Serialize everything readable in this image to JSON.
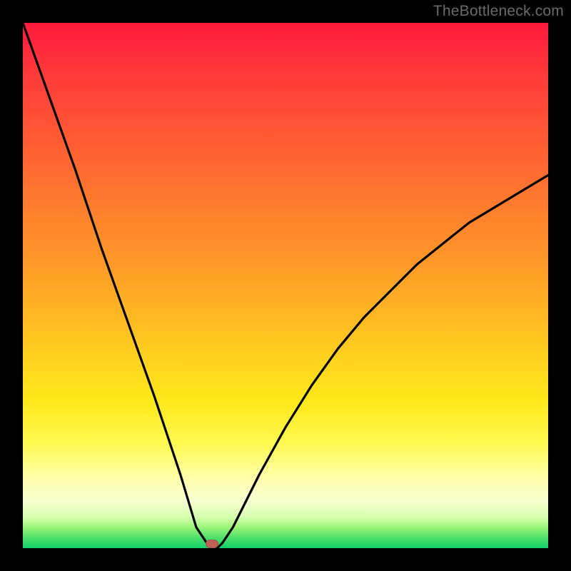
{
  "watermark": {
    "text": "TheBottleneck.com"
  },
  "chart_data": {
    "type": "line",
    "title": "",
    "xlabel": "",
    "ylabel": "",
    "xlim": [
      0,
      100
    ],
    "ylim": [
      0,
      100
    ],
    "grid": false,
    "series": [
      {
        "name": "bottleneck-curve",
        "x": [
          0,
          5,
          10,
          15,
          20,
          25,
          30,
          33,
          35,
          36,
          37,
          38,
          40,
          45,
          50,
          55,
          60,
          65,
          70,
          75,
          80,
          85,
          90,
          95,
          100
        ],
        "y": [
          100,
          86,
          72,
          57,
          43,
          29,
          14,
          4,
          1,
          0,
          0,
          1,
          4,
          14,
          23,
          31,
          38,
          44,
          49,
          54,
          58,
          62,
          65,
          68,
          71
        ]
      }
    ],
    "annotations": [
      {
        "name": "optimal-point",
        "x": 36,
        "y": 0
      }
    ],
    "background_gradient": {
      "orientation": "vertical",
      "stops": [
        {
          "pos": 0.0,
          "color": "#ff1a3d"
        },
        {
          "pos": 0.5,
          "color": "#ffb822"
        },
        {
          "pos": 0.8,
          "color": "#fff950"
        },
        {
          "pos": 1.0,
          "color": "#12d06a"
        }
      ]
    }
  }
}
